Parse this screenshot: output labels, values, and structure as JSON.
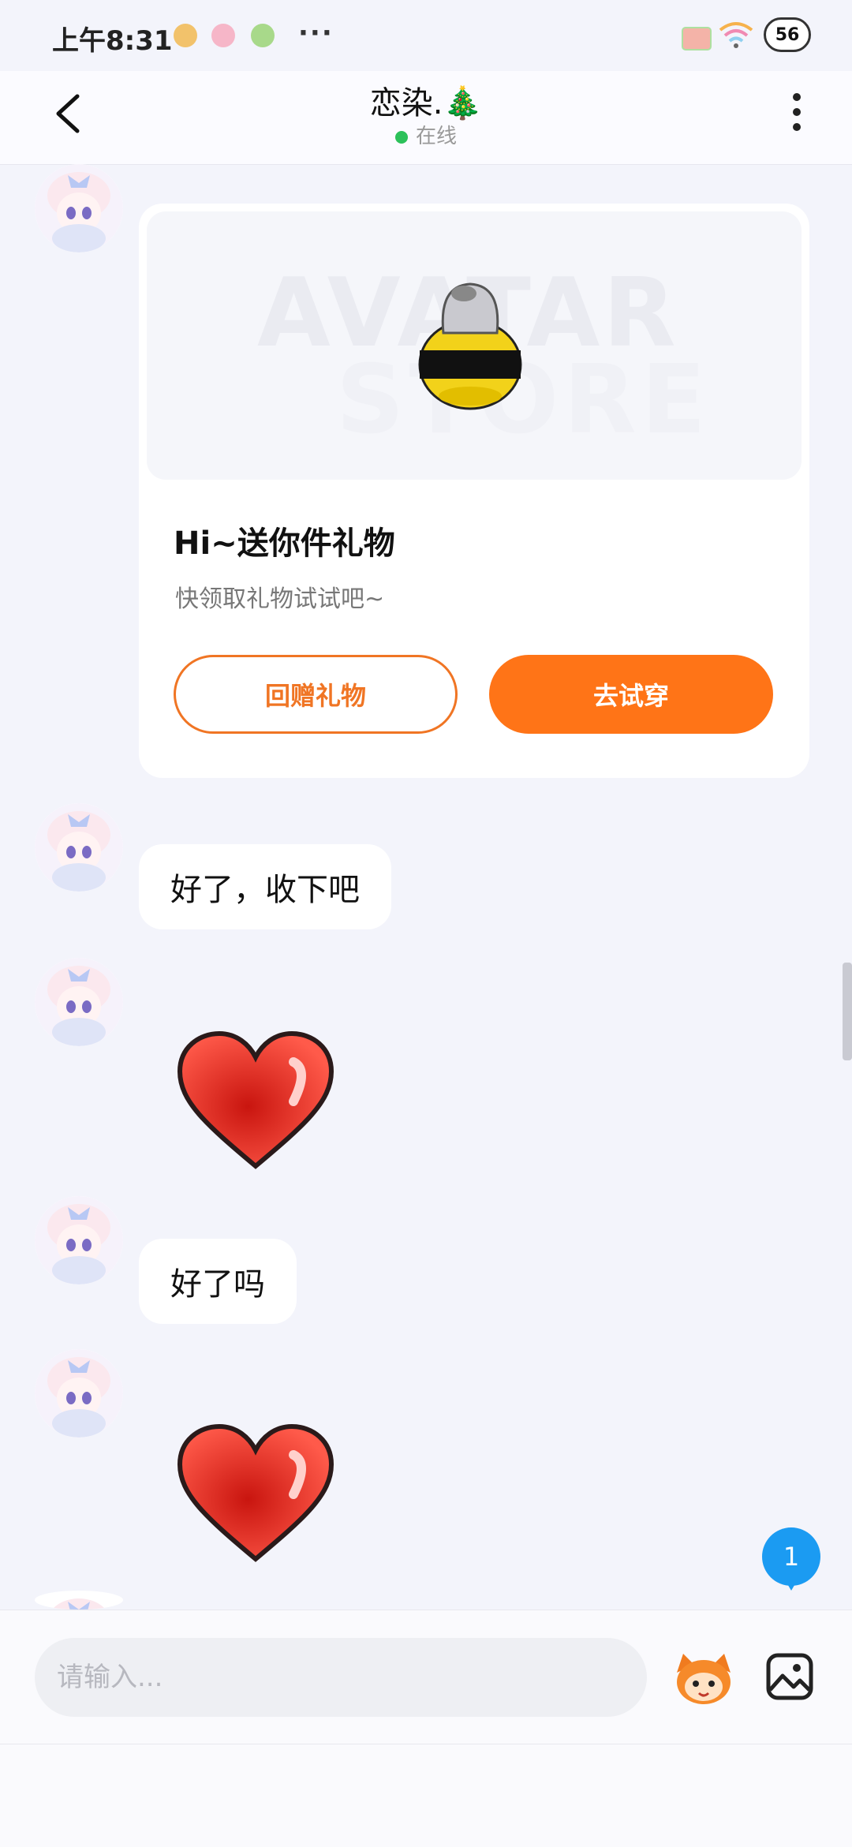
{
  "status_bar": {
    "time": "上午8:31",
    "more_dots": "···",
    "battery_level": "56"
  },
  "header": {
    "title": "恋染.🎄",
    "online_status": "在线"
  },
  "gift_card": {
    "watermark_line1": "AVATAR",
    "watermark_line2": "STORE",
    "title": "Hi~送你件礼物",
    "subtitle": "快领取礼物试试吧~",
    "return_gift_label": "回赠礼物",
    "try_on_label": "去试穿"
  },
  "messages": [
    {
      "type": "text",
      "text": "好了，收下吧"
    },
    {
      "type": "sticker",
      "sticker": "red-heart"
    },
    {
      "type": "text",
      "text": "好了吗"
    },
    {
      "type": "sticker",
      "sticker": "red-heart"
    }
  ],
  "unread_badge": "1",
  "input": {
    "placeholder": "请输入..."
  },
  "colors": {
    "accent_orange": "#ff7417",
    "online_green": "#2cc15a",
    "badge_blue": "#1b9bf2",
    "background": "#f3f4fb"
  }
}
